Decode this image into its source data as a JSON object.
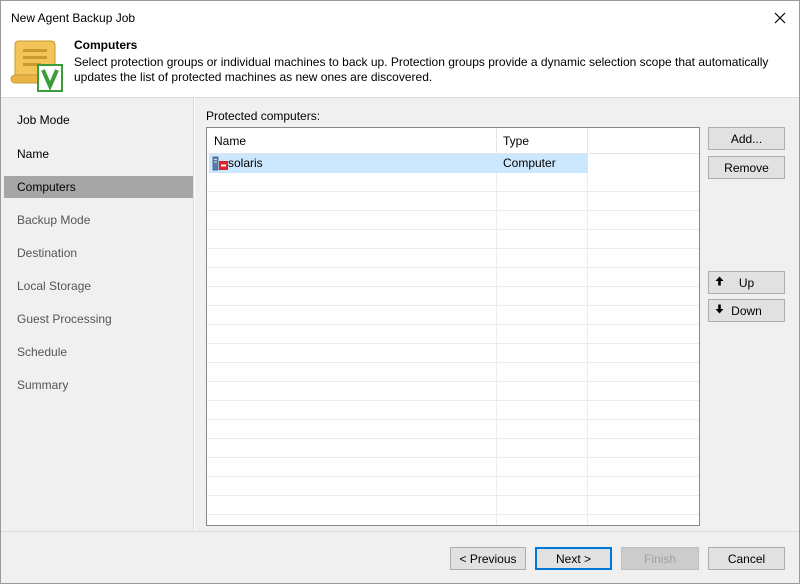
{
  "window": {
    "title": "New Agent Backup Job"
  },
  "header": {
    "title": "Computers",
    "description": "Select protection groups or individual machines to back up. Protection groups provide a dynamic selection scope that automatically updates the list of protected machines as new ones are discovered.",
    "icon": "wizard-scroll-veeam-icon"
  },
  "steps": [
    {
      "label": "Job Mode",
      "state": "done"
    },
    {
      "label": "Name",
      "state": "done"
    },
    {
      "label": "Computers",
      "state": "active"
    },
    {
      "label": "Backup Mode",
      "state": "pending"
    },
    {
      "label": "Destination",
      "state": "pending"
    },
    {
      "label": "Local Storage",
      "state": "pending"
    },
    {
      "label": "Guest Processing",
      "state": "pending"
    },
    {
      "label": "Schedule",
      "state": "pending"
    },
    {
      "label": "Summary",
      "state": "pending"
    }
  ],
  "main": {
    "list_label": "Protected computers:",
    "columns": [
      "Name",
      "Type"
    ],
    "rows": [
      {
        "name": "solaris",
        "type": "Computer",
        "icon": "computer-error-icon",
        "selected": true
      }
    ],
    "side_buttons": {
      "add": "Add...",
      "remove": "Remove",
      "up": "Up",
      "down": "Down"
    }
  },
  "footer": {
    "previous": "< Previous",
    "next": "Next >",
    "finish": "Finish",
    "cancel": "Cancel"
  },
  "colors": {
    "selection": "#cce8ff",
    "active_step": "#a6a6a6",
    "primary_border": "#0078d7",
    "error_badge": "#d9262c"
  }
}
